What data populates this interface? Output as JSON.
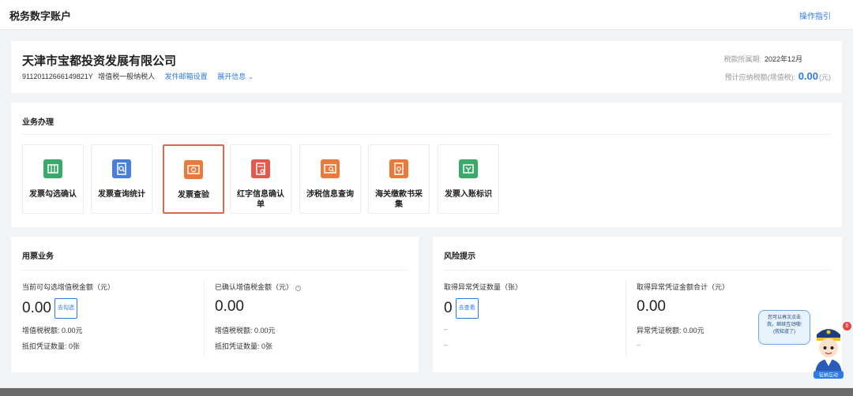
{
  "header": {
    "title": "税务数字账户",
    "guide_link": "操作指引"
  },
  "company": {
    "name": "天津市宝都投资发展有限公司",
    "tax_id": "91120112666149821Y",
    "taxpayer_type": "增值税一般纳税人",
    "mailbox_link": "发件邮箱设置",
    "expand_link": "展开信息",
    "period_label": "税款所属期:",
    "period_value": "2022年12月",
    "tax_label": "预计应纳税额(增值税):",
    "tax_amount": "0.00",
    "tax_unit": "(元)"
  },
  "business": {
    "title": "业务办理",
    "tiles": [
      {
        "label": "发票勾选确认",
        "icon": "invoice-select-icon",
        "color": "#3aaa6b"
      },
      {
        "label": "发票查询统计",
        "icon": "invoice-search-icon",
        "color": "#4a7fd9"
      },
      {
        "label": "发票查验",
        "icon": "invoice-verify-icon",
        "color": "#ea7a3c",
        "selected": true
      },
      {
        "label": "红字信息确认单",
        "icon": "red-letter-icon",
        "color": "#e25a4e"
      },
      {
        "label": "涉税信息查询",
        "icon": "tax-info-icon",
        "color": "#ea7a3c"
      },
      {
        "label": "海关缴款书采集",
        "icon": "customs-icon",
        "color": "#ea7a3c"
      },
      {
        "label": "发票入账标识",
        "icon": "invoice-account-icon",
        "color": "#3aaa6b"
      }
    ]
  },
  "usage": {
    "title": "用票业务",
    "left": {
      "label": "当前可勾选增值税金额（元）",
      "value": "0.00",
      "tag": "去勾选",
      "vat_label": "增值税税额:",
      "vat_value": "0.00元",
      "count_label": "抵扣凭证数量:",
      "count_value": "0张"
    },
    "right": {
      "label": "已确认增值税金额（元）",
      "value": "0.00",
      "vat_label": "增值税税额:",
      "vat_value": "0.00元",
      "count_label": "抵扣凭证数量:",
      "count_value": "0张"
    }
  },
  "risk": {
    "title": "风险提示",
    "left": {
      "label": "取得异常凭证数量（张）",
      "value": "0",
      "tag": "去查看",
      "dash1": "–",
      "dash2": "–"
    },
    "right": {
      "label": "取得异常凭证金额合计（元）",
      "value": "0.00",
      "tax_label": "异常凭证税额:",
      "tax_value": "0.00元",
      "dash": "–"
    }
  },
  "assistant": {
    "bubble_line1": "您可以再次点击",
    "bubble_line2": "我，继续互动哦!",
    "bubble_line3": "(我知道了)",
    "badge": "6",
    "caption": "征纳互动"
  }
}
